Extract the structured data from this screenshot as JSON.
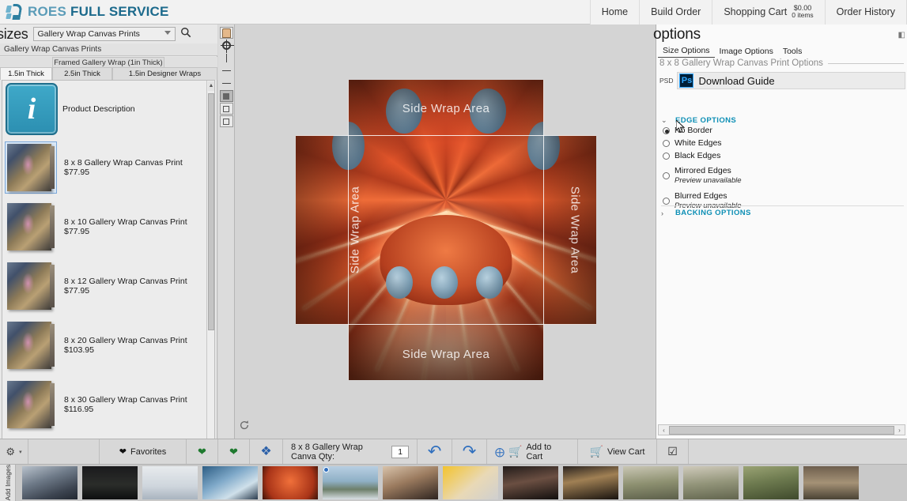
{
  "header": {
    "logo_roes": "ROES",
    "logo_full": "FULL SERVICE",
    "nav": [
      {
        "label": "Home"
      },
      {
        "label": "Build Order"
      },
      {
        "label": "Shopping Cart",
        "price": "$0.00",
        "items": "0 items"
      },
      {
        "label": "Order History"
      }
    ]
  },
  "left_panel": {
    "sizes_label": "sizes",
    "category_select_value": "Gallery Wrap Canvas Prints",
    "search_icon": "search-icon",
    "breadcrumb": "Gallery Wrap Canvas Prints",
    "tab_group_title": "Framed Gallery Wrap (1in Thick)",
    "tabs": [
      {
        "label": "1.5in Thick",
        "active": true
      },
      {
        "label": "2.5in Thick",
        "active": false
      },
      {
        "label": "1.5in Designer Wraps",
        "active": false
      }
    ],
    "info_row_label": "Product Description",
    "products": [
      {
        "label": "8 x 8 Gallery Wrap Canvas Print $77.95",
        "selected": true
      },
      {
        "label": "8 x 10 Gallery Wrap Canvas Print $77.95",
        "selected": false
      },
      {
        "label": "8 x 12 Gallery Wrap Canvas Print $77.95",
        "selected": false
      },
      {
        "label": "8 x 20 Gallery Wrap Canvas Print $103.95",
        "selected": false
      },
      {
        "label": "8 x 30 Gallery Wrap Canvas Print $116.95",
        "selected": false
      }
    ],
    "scroll_up": "▲",
    "scroll_down": "▼"
  },
  "toolstrip": {
    "tools": [
      {
        "name": "hand-tool-icon"
      },
      {
        "name": "move-tool-icon"
      },
      {
        "name": "align-vertical-icon"
      },
      {
        "name": "align-top-icon"
      },
      {
        "name": "align-bottom-icon"
      },
      {
        "name": "fill-node-icon"
      },
      {
        "name": "center-node-icon"
      },
      {
        "name": "grid-node-icon"
      }
    ]
  },
  "canvas": {
    "wrap_label_top": "Side Wrap Area",
    "wrap_label_bottom": "Side Wrap Area",
    "wrap_label_left": "Side Wrap Area",
    "wrap_label_right": "Side Wrap Area",
    "refresh_icon": "refresh-icon"
  },
  "options_panel": {
    "title": "options",
    "collapse_icon": "collapse-panel-icon",
    "tabs": [
      {
        "label": "Size Options",
        "active": true
      },
      {
        "label": "Image Options",
        "active": false
      },
      {
        "label": "Tools",
        "active": false
      }
    ],
    "legend": "8 x 8 Gallery Wrap Canvas Print Options",
    "psd_label": "PSD",
    "ps_badge": "Ps",
    "download_guide": "Download Guide",
    "edge_section": {
      "caret": "⌄",
      "title": "EDGE OPTIONS",
      "options": [
        {
          "label": "No Border",
          "selected": true,
          "sub": ""
        },
        {
          "label": "White Edges",
          "selected": false,
          "sub": ""
        },
        {
          "label": "Black Edges",
          "selected": false,
          "sub": ""
        },
        {
          "label": "Mirrored Edges",
          "selected": false,
          "sub": "Preview unavailable"
        },
        {
          "label": "Blurred Edges",
          "selected": false,
          "sub": "Preview unavailable"
        }
      ]
    },
    "backing_section": {
      "caret": "›",
      "title": "BACKING OPTIONS"
    },
    "hscroll_left": "‹",
    "hscroll_right": "›"
  },
  "bottom_toolbar": {
    "gear_icon": "gear-icon",
    "favorites_label": "Favorites",
    "favorites_icon": "heart-icon",
    "add_favorite_icon": "heart-add-icon",
    "remove_favorite_icon": "heart-remove-icon",
    "layers_icon": "layers-icon",
    "product_qty_label": "8 x 8 Gallery Wrap Canva Qty:",
    "qty_value": "1",
    "undo_icon": "undo-icon",
    "redo_icon": "redo-icon",
    "add_to_cart": "Add to Cart",
    "view_cart": "View Cart",
    "confirm_icon": "checkbox-check-icon"
  },
  "filmstrip": {
    "add_images_label": "Add Images",
    "thumbs": [
      {
        "name": "thumb-couple-snow",
        "css": "linear-gradient(160deg,#b9c2cc,#6e7a88 40%,#3c4450 75%,#222831)"
      },
      {
        "name": "thumb-dark-forest",
        "css": "linear-gradient(180deg,#1a1a1c,#2b2d2a 55%,#0e0f10)"
      },
      {
        "name": "thumb-snow-field",
        "css": "linear-gradient(180deg,#e7eaed,#cfd6dd 60%,#a9b4bf)"
      },
      {
        "name": "thumb-winter-sparkler",
        "css": "linear-gradient(150deg,#2d5d84,#7fa9c9 40%,#cfe0ea 70%,#2a3b4d)"
      },
      {
        "name": "thumb-carousel-orange",
        "css": "radial-gradient(circle at 50% 45%,#f0703a,#a93418 70%,#3c1409)"
      },
      {
        "name": "thumb-bride-lake",
        "css": "linear-gradient(180deg,#b8cfe2,#8fb0c6 45%,#6d7f6a 70%,#d8dfe4)"
      },
      {
        "name": "thumb-portrait-curly",
        "css": "linear-gradient(160deg,#d8c3ab,#9a7a5e 45%,#2e2420)"
      },
      {
        "name": "thumb-sunflower",
        "css": "linear-gradient(140deg,#f3c32e,#e9d9b6 55%,#cfcfcf)"
      },
      {
        "name": "thumb-portrait-dark",
        "css": "linear-gradient(170deg,#221c1a,#6b4f42 45%,#120f0e)"
      },
      {
        "name": "thumb-portrait-gold",
        "css": "linear-gradient(170deg,#2a2320,#a08054 40%,#18130f)"
      },
      {
        "name": "thumb-family-park-a",
        "css": "linear-gradient(175deg,#c9c6b4,#8e9171 50%,#5c5f4a)"
      },
      {
        "name": "thumb-family-park-b",
        "css": "linear-gradient(175deg,#cfcabb,#93957a 50%,#62654e)"
      },
      {
        "name": "thumb-family-tree",
        "css": "linear-gradient(170deg,#9aa374,#6d7a4f 45%,#3f4a2c)"
      },
      {
        "name": "thumb-boy-tree",
        "css": "linear-gradient(180deg,#6e5f4e,#a59276 50%,#4a4234)"
      }
    ]
  }
}
